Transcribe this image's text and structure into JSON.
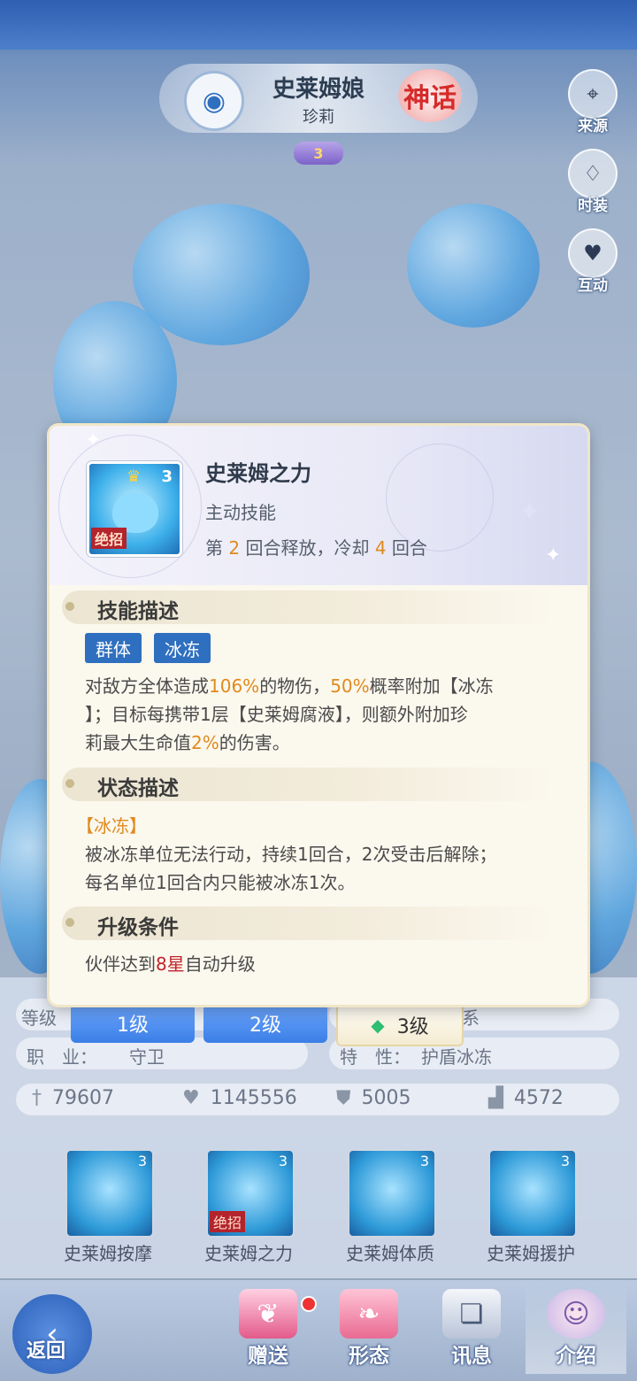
{
  "hero": {
    "name": "史莱姆娘",
    "subtitle": "珍莉",
    "rarity": "神话",
    "star_level": "3"
  },
  "side_buttons": [
    {
      "label": "来源",
      "icon": "location-pin-icon"
    },
    {
      "label": "时装",
      "icon": "dress-icon"
    },
    {
      "label": "互动",
      "icon": "heart-icon"
    }
  ],
  "info": {
    "level_row_label": "等级",
    "faction_suffix": "系",
    "job_label": "职　业：",
    "job_value": "守卫",
    "trait_label": "特　性：",
    "trait_value": "护盾冰冻"
  },
  "level_tabs": [
    {
      "label": "1级"
    },
    {
      "label": "2级"
    },
    {
      "label": "3级"
    }
  ],
  "stats": [
    {
      "icon": "sword-icon",
      "value": "79607"
    },
    {
      "icon": "heart-icon",
      "value": "1145556"
    },
    {
      "icon": "shield-icon",
      "value": "5005"
    },
    {
      "icon": "boot-icon",
      "value": "4572"
    }
  ],
  "skills": [
    {
      "name": "史莱姆按摩",
      "level": "3",
      "ult": ""
    },
    {
      "name": "史莱姆之力",
      "level": "3",
      "ult": "绝招"
    },
    {
      "name": "史莱姆体质",
      "level": "3",
      "ult": ""
    },
    {
      "name": "史莱姆援护",
      "level": "3",
      "ult": ""
    }
  ],
  "bottom_nav": {
    "back": "返回",
    "items": [
      {
        "label": "赠送",
        "icon": "gift-book-icon"
      },
      {
        "label": "形态",
        "icon": "wings-icon"
      },
      {
        "label": "讯息",
        "icon": "open-book-icon"
      },
      {
        "label": "介绍",
        "icon": "portrait-icon"
      }
    ]
  },
  "popup": {
    "skill_level": "3",
    "ult_tag": "绝招",
    "title": "史莱姆之力",
    "type": "主动技能",
    "cd_prefix": "第 ",
    "cd_turn": "2",
    "cd_mid": " 回合释放，冷却 ",
    "cd_cool": "4",
    "cd_suffix": " 回合",
    "desc_title": "技能描述",
    "tags": [
      "群体",
      "冰冻"
    ],
    "desc": {
      "p1": "对敌方全体造成",
      "v1": "106%",
      "p2": "的物伤，",
      "v2": "50%",
      "p3": "概率附加【冰冻",
      "line2": "】；目标每携带1层【史莱姆腐液】，则额外附加珍",
      "p4": "莉最大生命值",
      "v3": "2%",
      "p5": "的伤害。"
    },
    "status_title": "状态描述",
    "status_name": "【冰冻】",
    "status_line1": "被冰冻单位无法行动，持续1回合，2次受击后解除；",
    "status_line2": "每名单位1回合内只能被冰冻1次。",
    "upgrade_title": "升级条件",
    "upgrade_p1": "伙伴达到",
    "upgrade_v": "8星",
    "upgrade_p2": "自动升级"
  },
  "colors": {
    "accent_blue": "#2f6fbf",
    "highlight_orange": "#e08a1e",
    "highlight_red": "#c2232b",
    "ult_red": "#b3242c"
  }
}
